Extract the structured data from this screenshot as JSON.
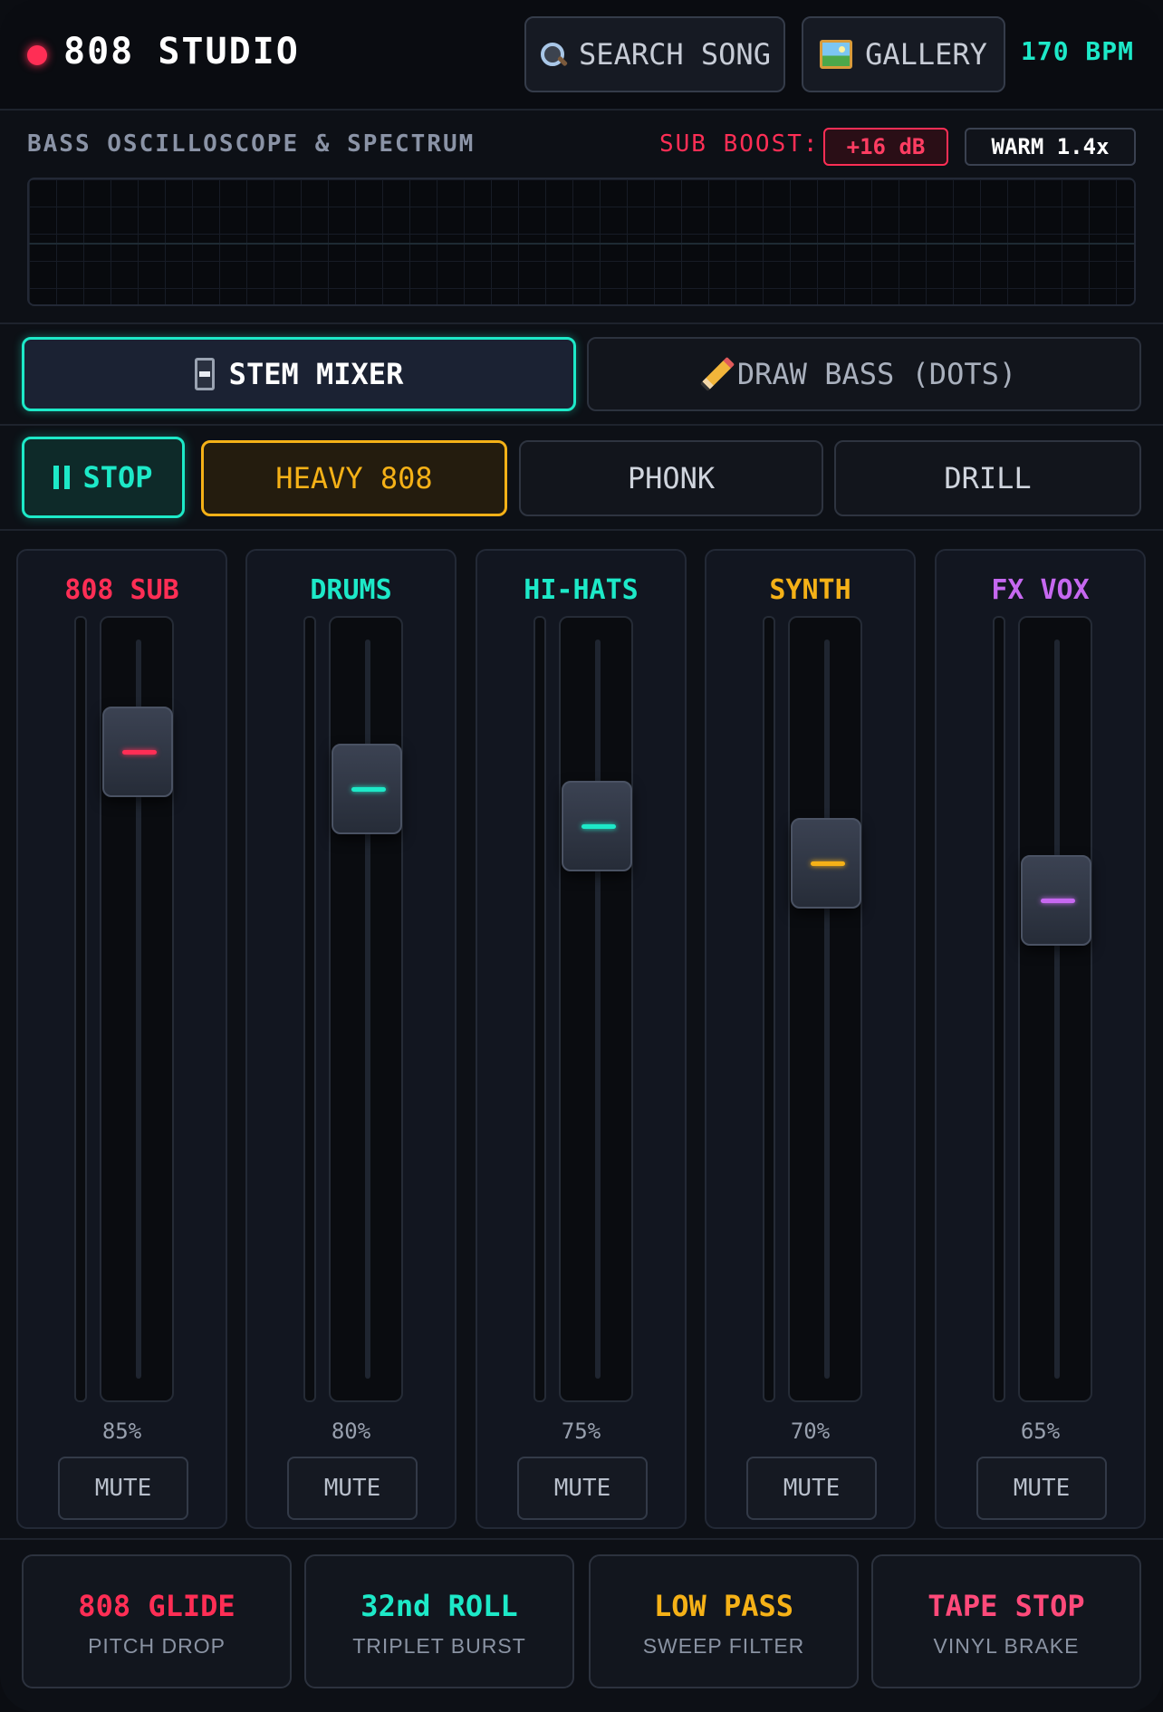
{
  "header": {
    "title": "808 STUDIO",
    "search_label": "SEARCH SONG",
    "gallery_label": "GALLERY",
    "bpm": "170 BPM",
    "accent_color": "#1de9c8",
    "record_color": "#ff2e55"
  },
  "scope": {
    "label": "BASS OSCILLOSCOPE & SPECTRUM",
    "sub_boost_label": "SUB BOOST:",
    "sub_boost_value": "+16 dB",
    "warm_value": "WARM 1.4x"
  },
  "tabs": {
    "mixer_label": "STEM MIXER",
    "draw_label": "DRAW BASS (DOTS)"
  },
  "presets": {
    "stop_label": "STOP",
    "items": [
      "HEAVY 808",
      "PHONK",
      "DRILL"
    ],
    "active": "HEAVY 808"
  },
  "channels": [
    {
      "name": "808 SUB",
      "level": 0.85,
      "value_label": "85%",
      "color": "#ff2e55",
      "mute_label": "MUTE"
    },
    {
      "name": "DRUMS",
      "level": 0.8,
      "value_label": "80%",
      "color": "#1de9c8",
      "mute_label": "MUTE"
    },
    {
      "name": "HI-HATS",
      "level": 0.75,
      "value_label": "75%",
      "color": "#1de9c8",
      "mute_label": "MUTE"
    },
    {
      "name": "SYNTH",
      "level": 0.7,
      "value_label": "70%",
      "color": "#f5b117",
      "mute_label": "MUTE"
    },
    {
      "name": "FX VOX",
      "level": 0.65,
      "value_label": "65%",
      "color": "#c668f0",
      "mute_label": "MUTE"
    }
  ],
  "fx_pads": [
    {
      "title": "808 GLIDE",
      "subtitle": "PITCH DROP",
      "color": "#ff2e55"
    },
    {
      "title": "32nd ROLL",
      "subtitle": "TRIPLET BURST",
      "color": "#1de9c8"
    },
    {
      "title": "LOW PASS",
      "subtitle": "SWEEP FILTER",
      "color": "#f5b117"
    },
    {
      "title": "TAPE STOP",
      "subtitle": "VINYL BRAKE",
      "color": "#ff4a7a"
    }
  ]
}
